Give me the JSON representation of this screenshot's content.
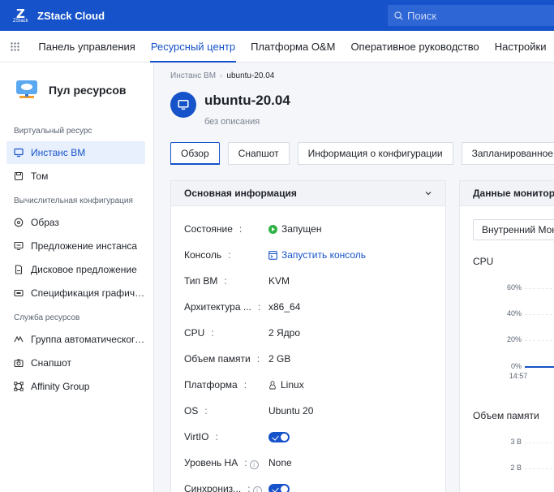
{
  "app": {
    "logo_text": "ZStack Cloud",
    "logo_sub": "ZStack"
  },
  "search": {
    "placeholder": "Поиск"
  },
  "nav": {
    "items": [
      {
        "label": "Панель управления",
        "active": false
      },
      {
        "label": "Ресурсный центр",
        "active": true
      },
      {
        "label": "Платформа O&M",
        "active": false
      },
      {
        "label": "Оперативное руководство",
        "active": false
      },
      {
        "label": "Настройки",
        "active": false
      }
    ]
  },
  "sidebar": {
    "title": "Пул ресурсов",
    "groups": [
      {
        "label": "Виртуальный ресурс",
        "items": [
          {
            "label": "Инстанс ВМ",
            "icon": "monitor-icon",
            "active": true
          },
          {
            "label": "Том",
            "icon": "disk-icon"
          }
        ]
      },
      {
        "label": "Вычислительная конфигурация",
        "items": [
          {
            "label": "Образ",
            "icon": "disc-icon"
          },
          {
            "label": "Предложение инстанса",
            "icon": "offering-icon"
          },
          {
            "label": "Дисковое предложение",
            "icon": "file-icon"
          },
          {
            "label": "Спецификация графиче…",
            "icon": "gpu-icon"
          }
        ]
      },
      {
        "label": "Служба ресурсов",
        "items": [
          {
            "label": "Группа автоматического…",
            "icon": "scaling-icon"
          },
          {
            "label": "Снапшот",
            "icon": "camera-icon"
          },
          {
            "label": "Affinity Group",
            "icon": "affinity-icon"
          }
        ]
      }
    ]
  },
  "breadcrumb": {
    "parent": "Инстанс ВМ",
    "current": "ubuntu-20.04"
  },
  "vm": {
    "name": "ubuntu-20.04",
    "description": "без описания"
  },
  "tabs": [
    {
      "label": "Обзор",
      "active": true
    },
    {
      "label": "Снапшот"
    },
    {
      "label": "Информация о конфигурации"
    },
    {
      "label": "Запланированное з"
    }
  ],
  "basic_info": {
    "title": "Основная информация",
    "rows": [
      {
        "key": "Состояние",
        "value": "Запущен",
        "kind": "status"
      },
      {
        "key": "Консоль",
        "value": "Запустить консоль",
        "kind": "link"
      },
      {
        "key": "Тип ВМ",
        "value": "KVM"
      },
      {
        "key": "Архитектура ...",
        "value": "x86_64"
      },
      {
        "key": "CPU",
        "value": "2 Ядро"
      },
      {
        "key": "Объем памяти",
        "value": "2 GB"
      },
      {
        "key": "Платформа",
        "value": "Linux",
        "kind": "linux"
      },
      {
        "key": "OS",
        "value": "Ubuntu 20"
      },
      {
        "key": "VirtIO",
        "value": "",
        "kind": "toggle",
        "on": true
      },
      {
        "key": "Уровень HA",
        "value": "None",
        "kind": "info"
      },
      {
        "key": "Синхрониз...",
        "value": "",
        "kind": "toggle-info",
        "on": true
      }
    ]
  },
  "monitor": {
    "title": "Данные мониторин",
    "select_value": "Внутренний Мон",
    "cpu_label": "CPU",
    "cpu_ticks": [
      "60%",
      "40%",
      "20%",
      "0%"
    ],
    "cpu_time": "14:57",
    "mem_label": "Объем памяти",
    "mem_ticks": [
      "3 B",
      "2 B"
    ]
  },
  "colors": {
    "brand": "#1652c9",
    "status_running": "#2fb344"
  }
}
